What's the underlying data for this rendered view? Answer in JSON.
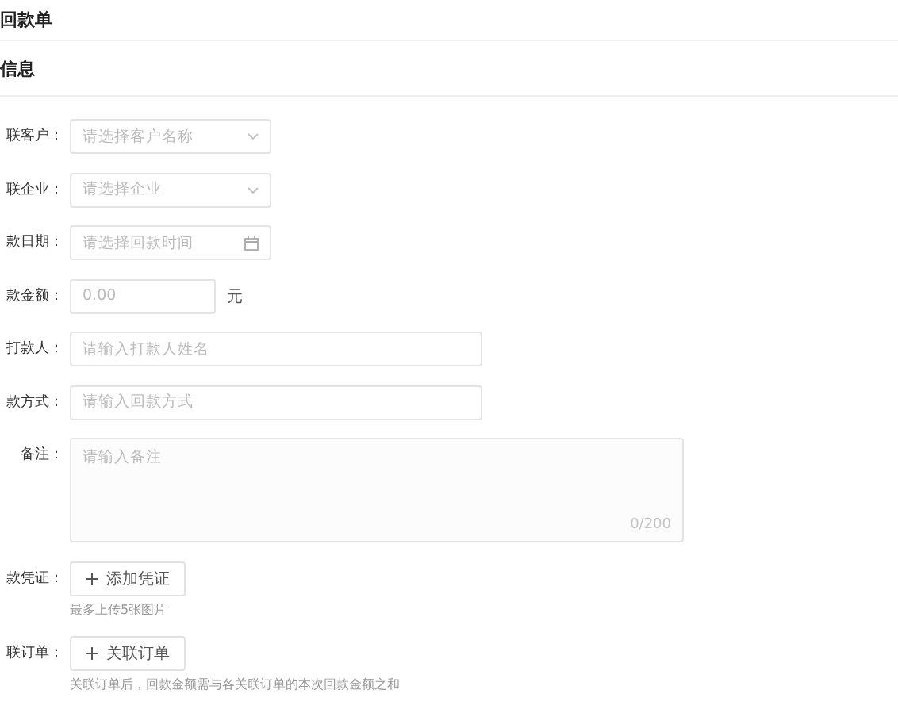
{
  "page": {
    "title": "回款单"
  },
  "section": {
    "title": "信息"
  },
  "fields": [
    {
      "kind": "select",
      "label": "联客户：",
      "placeholder": "请选择客户名称"
    },
    {
      "kind": "select",
      "label": "联企业：",
      "placeholder": "请选择企业"
    },
    {
      "kind": "date",
      "label": "款日期：",
      "placeholder": "请选择回款时间"
    },
    {
      "kind": "amount",
      "label": "款金额：",
      "placeholder": "0.00",
      "unit": "元"
    },
    {
      "kind": "text",
      "label": "打款人：",
      "placeholder": "请输入打款人姓名"
    },
    {
      "kind": "text",
      "label": "款方式：",
      "placeholder": "请输入回款方式"
    },
    {
      "kind": "textarea",
      "label": "备注：",
      "placeholder": "请输入备注",
      "counter": "0/200"
    },
    {
      "kind": "upload",
      "label": "款凭证：",
      "button": "添加凭证",
      "hint": "最多上传5张图片"
    },
    {
      "kind": "upload",
      "label": "联订单：",
      "button": "关联订单",
      "hint": "关联订单后，回款金额需与各关联订单的本次回款金额之和"
    }
  ]
}
